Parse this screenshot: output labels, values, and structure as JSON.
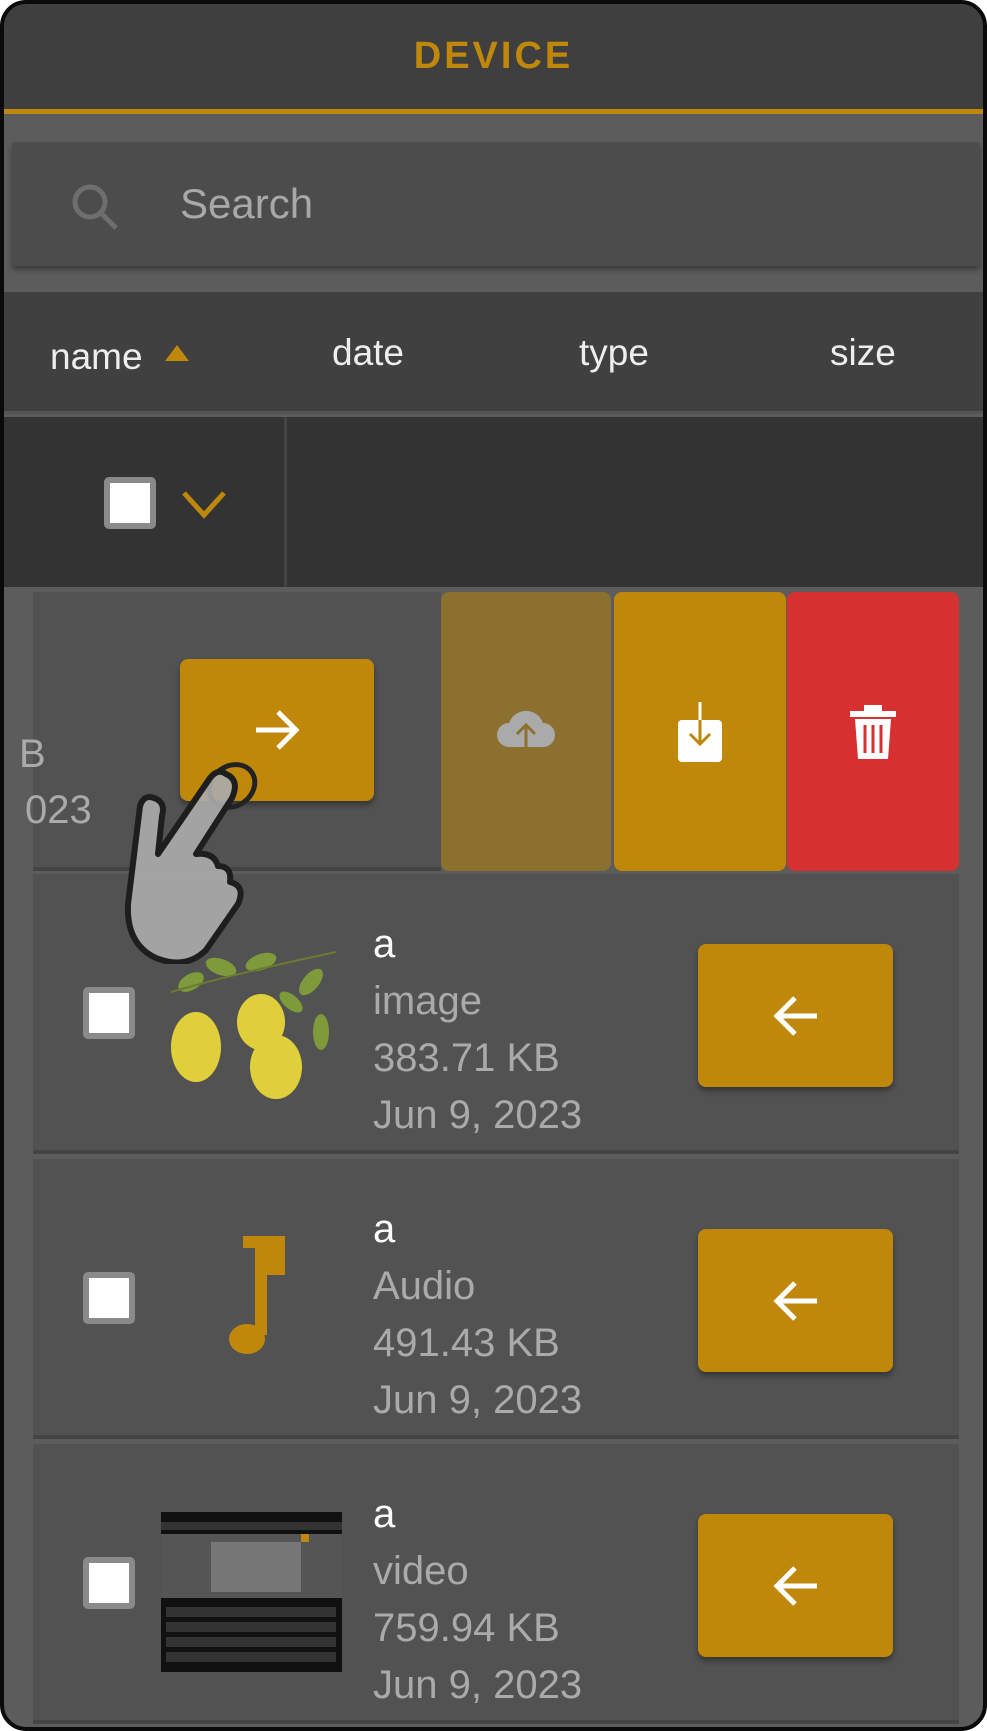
{
  "header": {
    "title": "DEVICE"
  },
  "search": {
    "placeholder": "Search"
  },
  "columns": [
    {
      "label": "name",
      "sorted": "ascending"
    },
    {
      "label": "date"
    },
    {
      "label": "type"
    },
    {
      "label": "size"
    }
  ],
  "swiped_row": {
    "partial_size": "B",
    "partial_date": "023",
    "actions": [
      {
        "name": "upload-cloud",
        "color": "#8c7030"
      },
      {
        "name": "download",
        "color": "#c0880a"
      },
      {
        "name": "delete",
        "color": "#d63031"
      }
    ]
  },
  "files": [
    {
      "name": "a",
      "type": "image",
      "size": "383.71 KB",
      "date": "Jun 9, 2023",
      "thumbnail": "lemon-branch"
    },
    {
      "name": "a",
      "type": "Audio",
      "size": "491.43 KB",
      "date": "Jun 9, 2023",
      "thumbnail": "music-note-icon"
    },
    {
      "name": "a",
      "type": "video",
      "size": "759.94 KB",
      "date": "Jun 9, 2023",
      "thumbnail": "video-screenshot"
    }
  ],
  "colors": {
    "accent": "#c0880a",
    "danger": "#d63031",
    "header_bg": "#3f3f3f"
  }
}
